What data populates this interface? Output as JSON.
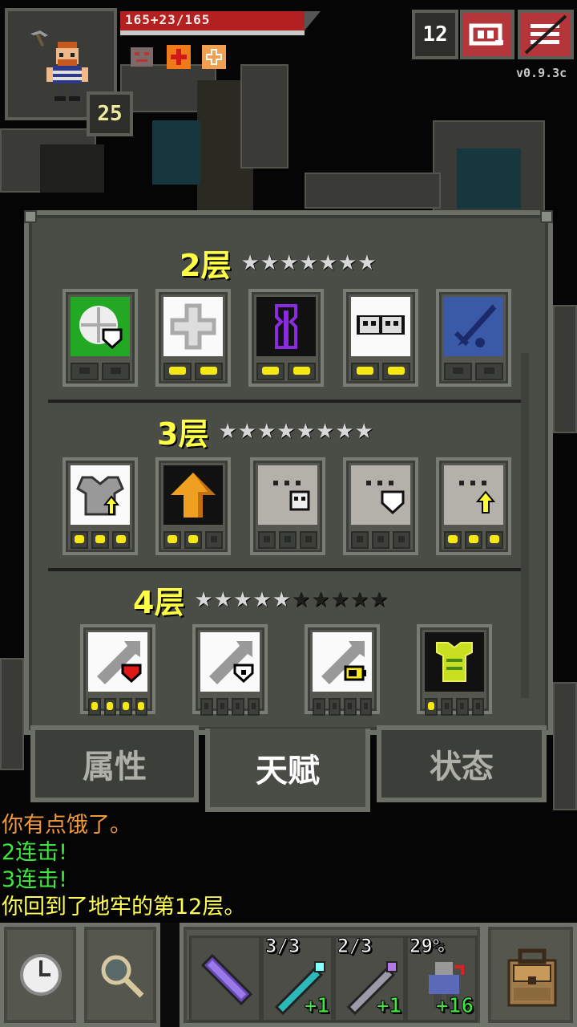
{
  "hud": {
    "hp_text": "165+23/165",
    "hero_level": "25",
    "depth": "12",
    "version": "v0.9.3c",
    "buff_icons": [
      "mask-buff-icon",
      "bless-buff-icon",
      "heal-buff-icon"
    ]
  },
  "talents": {
    "tier2": {
      "label": "2层",
      "stars_filled": 7,
      "stars_total": 7,
      "items": [
        {
          "icon": "shield-bounce-icon",
          "points": 0,
          "max": 2
        },
        {
          "icon": "holy-cross-icon",
          "points": 2,
          "max": 2
        },
        {
          "icon": "purple-rune-icon",
          "points": 2,
          "max": 2
        },
        {
          "icon": "twin-skull-icon",
          "points": 2,
          "max": 2
        },
        {
          "icon": "blue-dagger-icon",
          "points": 0,
          "max": 2
        }
      ]
    },
    "tier3": {
      "label": "3层",
      "stars_filled": 8,
      "stars_total": 8,
      "items": [
        {
          "icon": "armor-upgrade-icon",
          "points": 3,
          "max": 3
        },
        {
          "icon": "orange-arrow-icon",
          "points": 2,
          "max": 3
        },
        {
          "icon": "skull-effigy-icon",
          "points": 0,
          "max": 3
        },
        {
          "icon": "shield-effigy-icon",
          "points": 0,
          "max": 3
        },
        {
          "icon": "bless-effigy-icon",
          "points": 3,
          "max": 3
        }
      ]
    },
    "tier4": {
      "label": "4层",
      "stars_filled": 5,
      "stars_total": 10,
      "items": [
        {
          "icon": "heart-strike-icon",
          "points": 4,
          "max": 4
        },
        {
          "icon": "shield-strike-icon",
          "points": 0,
          "max": 4
        },
        {
          "icon": "battery-strike-icon",
          "points": 0,
          "max": 4
        },
        {
          "icon": "green-robe-icon",
          "points": 1,
          "max": 4
        }
      ]
    }
  },
  "tabs": [
    {
      "label": "属性",
      "active": false
    },
    {
      "label": "天赋",
      "active": true
    },
    {
      "label": "状态",
      "active": false
    }
  ],
  "log": [
    {
      "text": "你有点饿了。",
      "color": "#f2993a"
    },
    {
      "text": "2连击!",
      "color": "#3ee83e"
    },
    {
      "text": "3连击!",
      "color": "#3ee83e"
    },
    {
      "text": "你回到了地牢的第12层。",
      "color": "#ffff55"
    }
  ],
  "quickslots": [
    {
      "icon": "purple-wand-icon",
      "charges": "",
      "bonus": ""
    },
    {
      "icon": "cyan-wand-icon",
      "charges": "3/3",
      "bonus": "+1"
    },
    {
      "icon": "grey-wand-icon",
      "charges": "2/3",
      "bonus": "+1"
    },
    {
      "icon": "armor-figure-icon",
      "charges": "29%",
      "bonus": "+16"
    }
  ],
  "colors": {
    "hp": "#b32020",
    "tier_label": "#ffff44",
    "pip_on": "#f5e813",
    "bonus_green": "#3ee83e",
    "top_button": "#b5363a"
  }
}
